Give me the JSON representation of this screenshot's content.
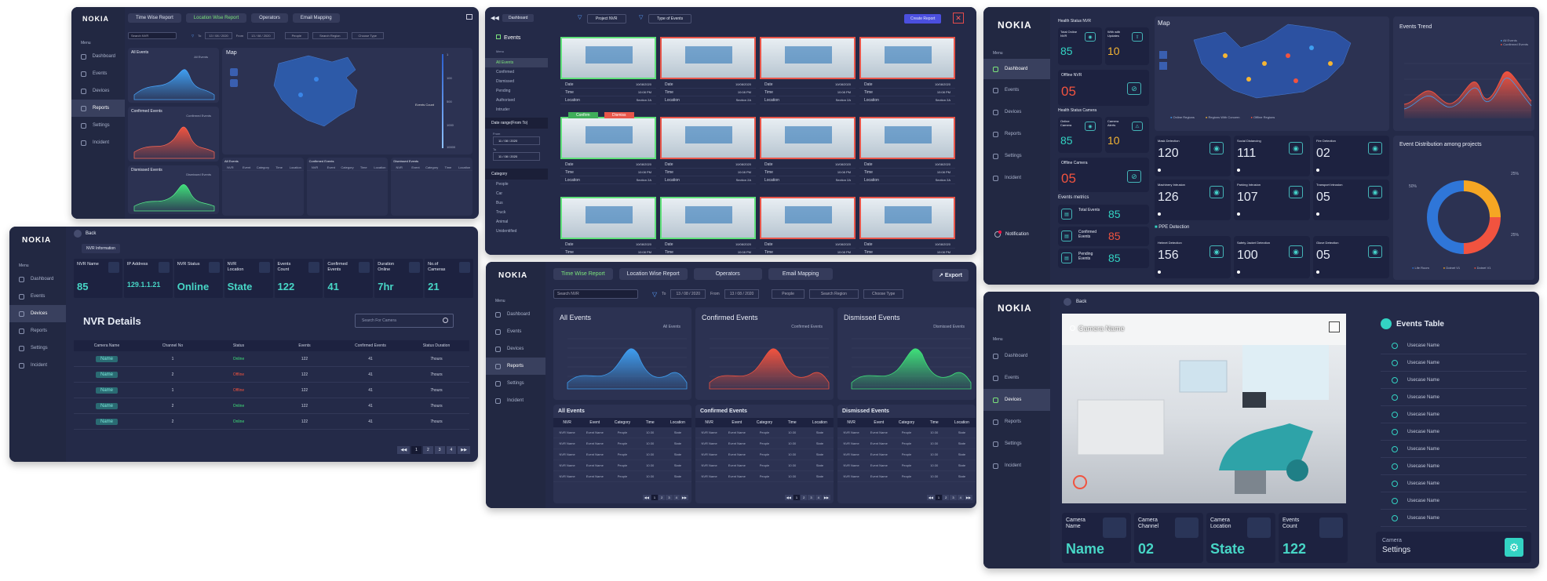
{
  "brand": "NOKIA",
  "nav": {
    "menu": "Menu",
    "dashboard": "Dashboard",
    "events": "Events",
    "devices": "Devices",
    "reports": "Reports",
    "settings": "Settings",
    "incident": "Incident",
    "notification": "Notification"
  },
  "p1": {
    "tabs": [
      "Time Wise Report",
      "Location Wise Report",
      "Operators",
      "Email Mapping"
    ],
    "search_placeholder": "Search NVR",
    "to": "To",
    "from": "From",
    "date": "13 / 08 / 2020",
    "people": "People",
    "search_region": "Search Region",
    "choose_type": "Choose Type",
    "all_events": "All Events",
    "all_events_legend": "All Events",
    "confirmed_events": "Confirmed Events",
    "confirmed_legend": "Confirmed Events",
    "dismissed_events": "Dismissed Events",
    "dismissed_legend": "Dismissed Events",
    "map": "Map",
    "events_count": "Events Count",
    "scale": [
      "1",
      "100",
      "500",
      "1000",
      "10000"
    ],
    "tbl_titles": [
      "All Events",
      "Confirmed Events",
      "Dismissed Events"
    ],
    "cols": [
      "NVR",
      "Event",
      "Category",
      "Time",
      "Location"
    ]
  },
  "p2": {
    "back": "Back",
    "nvr_info": "NVR Information",
    "stats": [
      {
        "label": "NVR Name",
        "value": "85",
        "icon": "camera-icon"
      },
      {
        "label": "IP Address",
        "value": "129.1.1.21",
        "icon": "network-icon"
      },
      {
        "label": "NVR Status",
        "value": "Online",
        "icon": "status-icon"
      },
      {
        "label": "NVR Location",
        "value": "State",
        "icon": "location-icon"
      },
      {
        "label": "Events Count",
        "value": "122",
        "icon": "calendar-icon"
      },
      {
        "label": "Confirmed Events",
        "value": "41",
        "icon": "check-icon"
      },
      {
        "label": "Duration Online",
        "value": "7hr",
        "icon": "clock-icon"
      },
      {
        "label": "No.of Cameras",
        "value": "21",
        "icon": "cctv-icon"
      }
    ],
    "title": "NVR Details",
    "search_placeholder": "Search For Camera",
    "cols": [
      "Camera Name",
      "Channel No",
      "Status",
      "Events",
      "Confirmed Events",
      "Status Duration"
    ],
    "rows": [
      {
        "name": "Name",
        "ch": "1",
        "status": "Online",
        "events": "122",
        "conf": "41",
        "dur": "7hours"
      },
      {
        "name": "Name",
        "ch": "2",
        "status": "Offline",
        "events": "122",
        "conf": "41",
        "dur": "7hours"
      },
      {
        "name": "Name",
        "ch": "1",
        "status": "Offline",
        "events": "122",
        "conf": "41",
        "dur": "7hours"
      },
      {
        "name": "Name",
        "ch": "2",
        "status": "Online",
        "events": "122",
        "conf": "41",
        "dur": "7hours"
      },
      {
        "name": "Name",
        "ch": "2",
        "status": "Online",
        "events": "122",
        "conf": "41",
        "dur": "7hours"
      }
    ],
    "pages": [
      "1",
      "2",
      "3",
      "4"
    ]
  },
  "p3": {
    "dashboard": "Dashboard",
    "project_nvr": "Project NVR",
    "type_events": "Type of Events",
    "create_report": "Create Report",
    "events": "Events",
    "menu": "Menu",
    "filters": [
      "All Events",
      "Confirmed",
      "Dismissed",
      "Pending",
      "Authorised",
      "Intruder"
    ],
    "date_range": "Date range(From To)",
    "from": "From",
    "to": "To",
    "date": "11 / 08 / 2020",
    "category": "Category",
    "categories": [
      "People",
      "Car",
      "Bus",
      "Truck",
      "Animal",
      "Unidentified"
    ],
    "meta": {
      "date": "Date",
      "time": "Time",
      "location": "Location",
      "date_v": "10/08/2020",
      "time_v": "10:08 PM",
      "loc_v": "Section 2A"
    },
    "confirm": "Confirm",
    "dismiss": "Dismiss"
  },
  "p4": {
    "tabs": [
      "Time Wise Report",
      "Location Wise Report",
      "Operators",
      "Email Mapping"
    ],
    "export": "Export",
    "search_placeholder": "Search NVR",
    "to": "To",
    "from": "From",
    "date": "13 / 08 / 2020",
    "people": "People",
    "search_region": "Search Region",
    "choose_type": "Choose Type",
    "charts": [
      {
        "title": "All Events",
        "legend": "All Events"
      },
      {
        "title": "Confirmed Events",
        "legend": "Confirmed Events"
      },
      {
        "title": "Dismissed Events",
        "legend": "Dismissed Events"
      }
    ],
    "cols": [
      "NVR",
      "Event",
      "Category",
      "Time",
      "Location"
    ],
    "row": [
      "NVR Name",
      "Event Name",
      "People",
      "10:30",
      "State"
    ],
    "pages": [
      "1",
      "2",
      "3",
      "4"
    ]
  },
  "p5": {
    "health_nvr": "Health Status NVR",
    "total_online": "Total Online NVR",
    "total_online_v": "85",
    "with_updates": "With with Updates",
    "with_updates_v": "10",
    "offline_nvr": "Offline NVR",
    "offline_nvr_v": "05",
    "health_cam": "Health Status Camera",
    "online_cam": "Online Camera",
    "online_cam_v": "85",
    "cam_alerts": "Camera Alerts",
    "cam_alerts_v": "10",
    "offline_cam": "Offline Camera",
    "offline_cam_v": "05",
    "metrics": "Events metrics",
    "m": [
      {
        "label": "Total Events",
        "v": "85"
      },
      {
        "label": "Confirmed Events",
        "v": "85"
      },
      {
        "label": "Pending Events",
        "v": "85"
      }
    ],
    "map": "Map",
    "legend": [
      "Online Regions",
      "Regions With Concern",
      "Offline Regions"
    ],
    "trend": "Events Trend",
    "trend_legend": [
      "All Events",
      "Confirmed Events"
    ],
    "detect": [
      {
        "label": "Mask Detection",
        "v": "120"
      },
      {
        "label": "Social Distancing",
        "v": "111"
      },
      {
        "label": "Fire Detection",
        "v": "02"
      },
      {
        "label": "Machinery Intrusion",
        "v": "126"
      },
      {
        "label": "Parking Intrusion",
        "v": "107"
      },
      {
        "label": "Transport Intrusion",
        "v": "05"
      }
    ],
    "ppe": "PPE Detection",
    "ppe_items": [
      {
        "label": "Helmet Detection",
        "v": "156"
      },
      {
        "label": "Safety Jacket Detection",
        "v": "100"
      },
      {
        "label": "Glove Detection",
        "v": "05"
      }
    ],
    "distribution": "Event Distribution among projects",
    "pct": [
      "50%",
      "25%",
      "25%"
    ],
    "dist_legend": [
      "Life Room",
      "Dotnet V1",
      "Dotnet V1"
    ]
  },
  "p6": {
    "back": "Back",
    "camera_name": "Camera Name",
    "events_table": "Events Table",
    "usecase": "Usecase Name",
    "stats": [
      {
        "label": "Camera Name",
        "v": "Name"
      },
      {
        "label": "Camera Channel",
        "v": "02"
      },
      {
        "label": "Camera Location",
        "v": "State"
      },
      {
        "label": "Events Count",
        "v": "122"
      }
    ],
    "camera": "Camera",
    "settings": "Settings"
  },
  "colors": {
    "bg": "#242a48",
    "teal": "#33d3c3",
    "blue": "#3f9ef0",
    "red": "#f1533f",
    "green": "#3fe07a",
    "orange": "#f5b533"
  }
}
